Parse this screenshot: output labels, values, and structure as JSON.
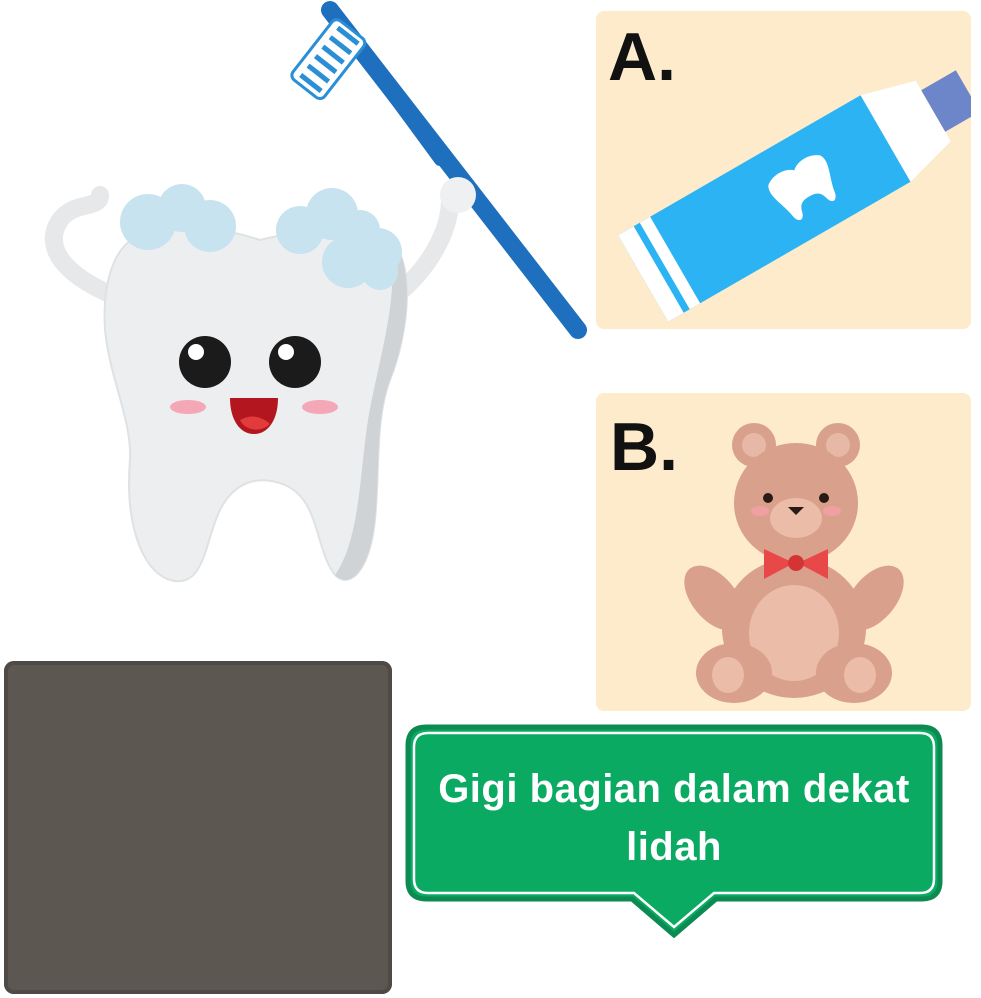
{
  "colors": {
    "card_bg": "#fdebcb",
    "dark_panel": "#5d5752",
    "bubble_green": "#0aaa63",
    "bubble_border": "#0b8a52",
    "toothbrush_blue": "#1f6fbf",
    "toothpaste_blue": "#2bb3f3"
  },
  "options": [
    {
      "letter": "A.",
      "image": "toothpaste-icon"
    },
    {
      "letter": "B.",
      "image": "teddy-bear-icon"
    }
  ],
  "question": {
    "text": "Gigi bagian dalam dekat lidah"
  },
  "icons": {
    "mascot": "tooth-mascot-icon",
    "brush": "toothbrush-icon"
  }
}
